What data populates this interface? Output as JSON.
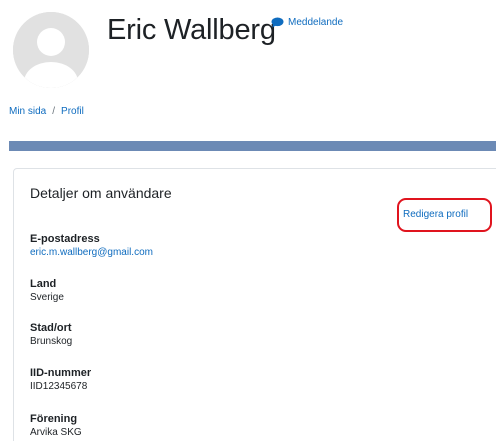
{
  "header": {
    "user_name": "Eric Wallberg",
    "message_label": "Meddelande",
    "avatar_icon": "user-avatar-icon",
    "message_icon": "speech-bubble-icon"
  },
  "breadcrumb": {
    "items": [
      "Min sida",
      "Profil"
    ],
    "separator": "/"
  },
  "colors": {
    "link": "#0f6cbf",
    "banner": "#6c8ab5",
    "highlight": "#e0141e"
  },
  "details": {
    "title": "Detaljer om användare",
    "edit_label": "Redigera profil",
    "fields": [
      {
        "label": "E-postadress",
        "value": "eric.m.wallberg@gmail.com"
      },
      {
        "label": "Land",
        "value": "Sverige"
      },
      {
        "label": "Stad/ort",
        "value": "Brunskog"
      },
      {
        "label": "IID-nummer",
        "value": "IID12345678"
      },
      {
        "label": "Förening",
        "value": "Arvika SKG"
      }
    ]
  }
}
